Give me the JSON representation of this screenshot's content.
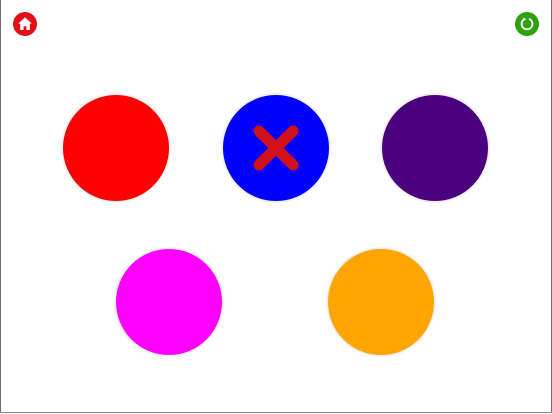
{
  "toolbar": {
    "home_icon": "home-icon",
    "restart_icon": "restart-icon",
    "home_color": "#e3101a",
    "restart_color": "#2ea20c"
  },
  "circles": [
    {
      "color_name": "red",
      "color": "#ff0000",
      "marked_wrong": false
    },
    {
      "color_name": "blue",
      "color": "#0000ff",
      "marked_wrong": true
    },
    {
      "color_name": "purple",
      "color": "#4b0080",
      "marked_wrong": false
    },
    {
      "color_name": "magenta",
      "color": "#ff00ff",
      "marked_wrong": false
    },
    {
      "color_name": "orange",
      "color": "#ffa500",
      "marked_wrong": false
    }
  ],
  "wrong_mark": {
    "icon": "x-mark-icon",
    "color": "#d2101c"
  }
}
